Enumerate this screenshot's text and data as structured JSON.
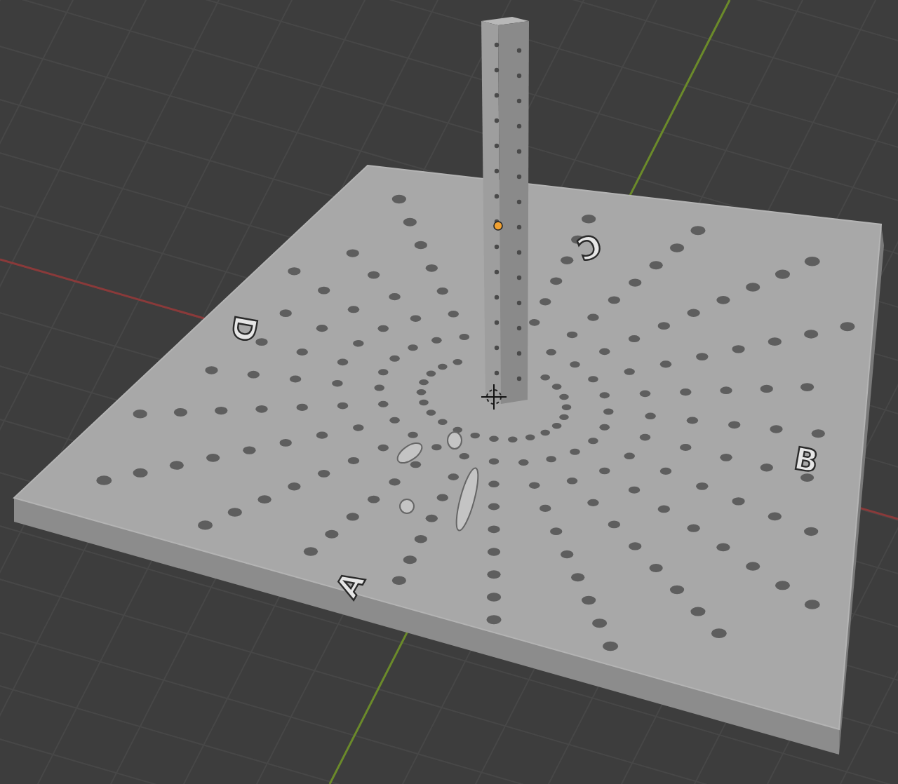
{
  "viewport": {
    "origin_selected": true
  },
  "embossed_letters": [
    {
      "text": "A"
    },
    {
      "text": "B"
    },
    {
      "text": "C"
    },
    {
      "text": "D"
    }
  ]
}
